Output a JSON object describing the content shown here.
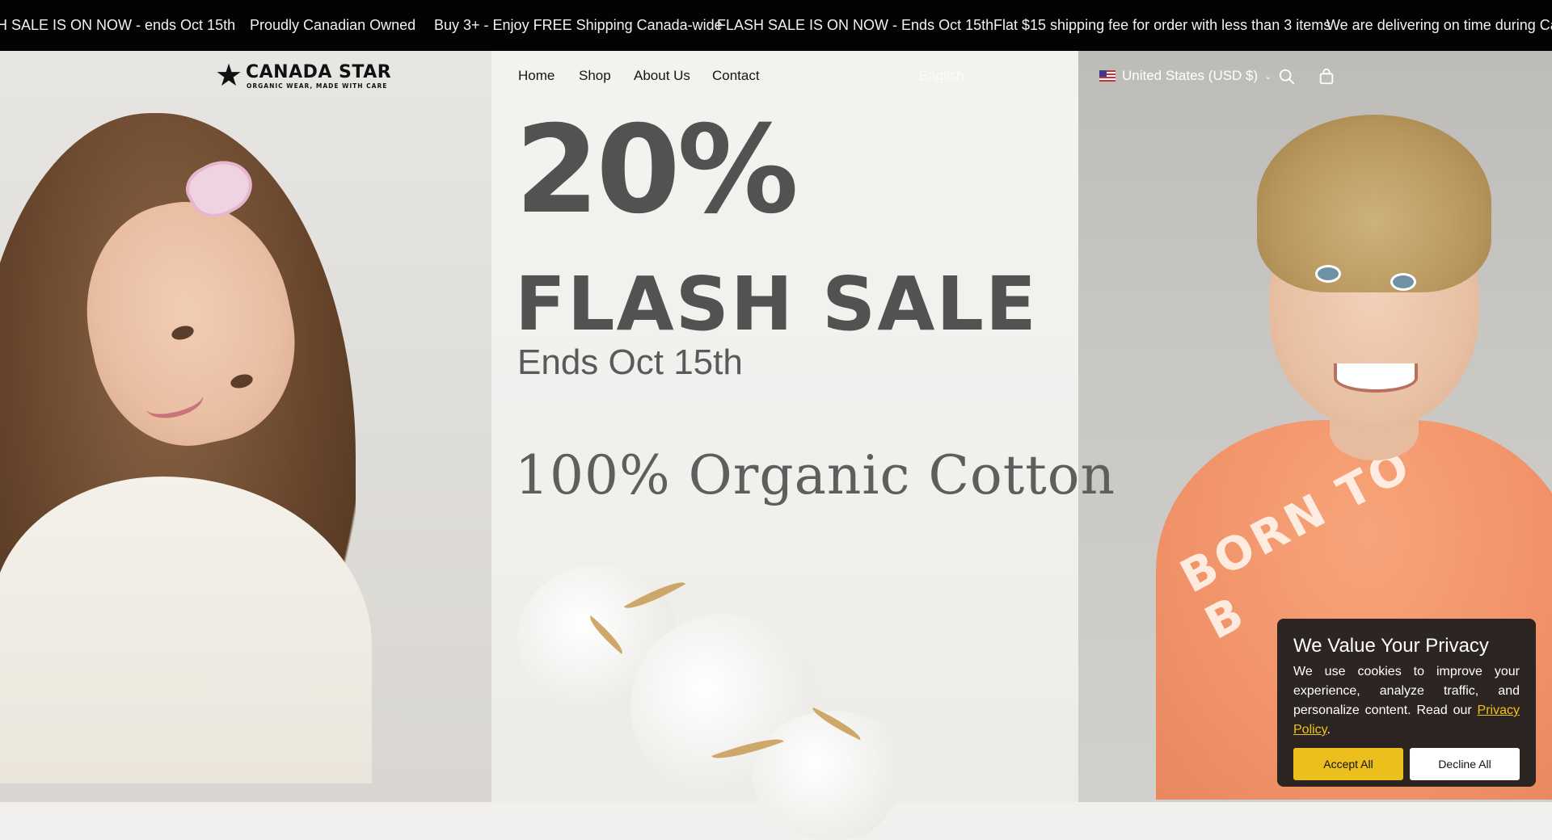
{
  "announcement": {
    "items": [
      "H SALE IS ON NOW - ends Oct 15th",
      "Proudly Canadian Owned",
      "Buy 3+ - Enjoy FREE Shipping Canada-wide",
      "FLASH SALE IS ON NOW - Ends Oct 15th",
      "Flat $15 shipping fee for order with less than 3 items",
      "We are delivering on time during Canada"
    ]
  },
  "header": {
    "logo": {
      "name": "CANADA STAR",
      "tagline": "ORGANIC WEAR, MADE WITH CARE"
    },
    "nav": [
      "Home",
      "Shop",
      "About Us",
      "Contact"
    ],
    "language": "English",
    "country": "United States (USD $)",
    "icons": {
      "search": "search-icon",
      "cart": "cart-icon",
      "flag": "us-flag-icon",
      "chevron": "chevron-down-icon"
    }
  },
  "hero": {
    "percent": "20%",
    "headline": "FLASH SALE",
    "subline": "Ends Oct 15th",
    "tagline": "100% Organic Cotton",
    "shirt_print": "BORN TO B"
  },
  "cookie": {
    "title": "We Value Your Privacy",
    "text": "We use cookies to improve your experience, analyze traffic, and personalize content. Read our ",
    "link": "Privacy Policy",
    "after_link": ".",
    "accept": "Accept All",
    "decline": "Decline All"
  },
  "colors": {
    "announcement_bg": "#030303",
    "accent": "#ecbf1d",
    "cookie_bg": "#1c1c1c",
    "hero_text": "#525252"
  }
}
